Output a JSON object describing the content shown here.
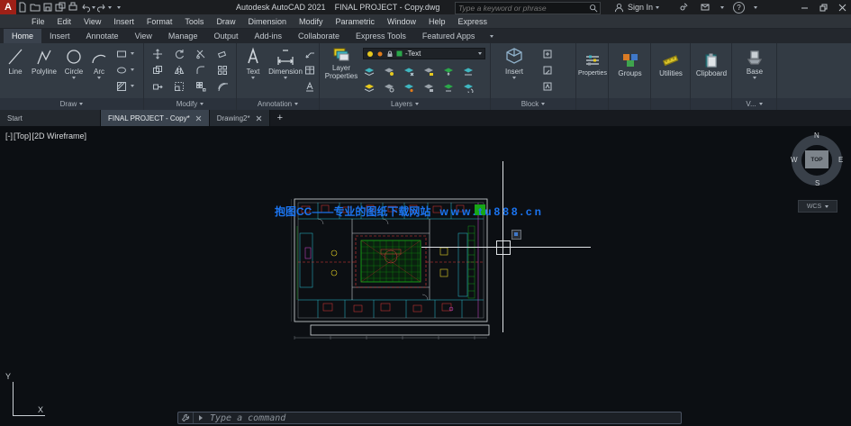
{
  "title_bar": {
    "app_name": "Autodesk AutoCAD 2021",
    "document_name": "FINAL PROJECT - Copy.dwg",
    "search_placeholder": "Type a keyword or phrase",
    "sign_in_label": "Sign In",
    "help_glyph": "?",
    "qat_icons": [
      "new-file-icon",
      "open-icon",
      "save-icon",
      "save-as-icon",
      "plot-icon",
      "undo-icon",
      "redo-icon",
      "qat-dropdown-icon"
    ]
  },
  "menu_bar": {
    "items": [
      "File",
      "Edit",
      "View",
      "Insert",
      "Format",
      "Tools",
      "Draw",
      "Dimension",
      "Modify",
      "Parametric",
      "Window",
      "Help",
      "Express"
    ]
  },
  "ribbon_tabs": {
    "items": [
      "Home",
      "Insert",
      "Annotate",
      "View",
      "Manage",
      "Output",
      "Add-ins",
      "Collaborate",
      "Express Tools",
      "Featured Apps"
    ],
    "active": "Home"
  },
  "ribbon": {
    "draw": {
      "label": "Draw",
      "line": "Line",
      "polyline": "Polyline",
      "circle": "Circle",
      "arc": "Arc"
    },
    "modify": {
      "label": "Modify"
    },
    "annotation": {
      "label": "Annotation",
      "text": "Text",
      "dimension": "Dimension"
    },
    "layers": {
      "label": "Layers",
      "properties_button": "Layer Properties",
      "current_layer": "-Text"
    },
    "block": {
      "label": "Block",
      "insert": "Insert"
    },
    "properties": {
      "button": "Properties"
    },
    "groups": {
      "button": "Groups"
    },
    "utilities": {
      "button": "Utilities"
    },
    "clipboard": {
      "button": "Clipboard"
    },
    "view": {
      "label": "V...",
      "base": "Base"
    }
  },
  "file_tabs": {
    "start": "Start",
    "active_tab": "FINAL PROJECT - Copy*",
    "tab2": "Drawing2*",
    "new_tab": "+"
  },
  "canvas": {
    "viewport_minus": "[-]",
    "viewport_view": "[Top]",
    "viewport_style": "[2D Wireframe]",
    "watermark_text": "抱图CC——专业的图纸下载网站",
    "watermark_url": "www.tu888.cn",
    "viewcube": {
      "n": "N",
      "s": "S",
      "e": "E",
      "w": "W",
      "face": "TOP"
    },
    "wcs_label": "WCS",
    "ucs_x": "X",
    "ucs_y": "Y",
    "drawing_colors": {
      "walls": "#29c5d6",
      "structure": "#d4d9dd",
      "courtyard": "#18b818",
      "dashed": "#e23a3a",
      "accent1": "#e3d024",
      "accent2": "#d84ad8"
    }
  },
  "command_line": {
    "placeholder": "Type a command"
  }
}
